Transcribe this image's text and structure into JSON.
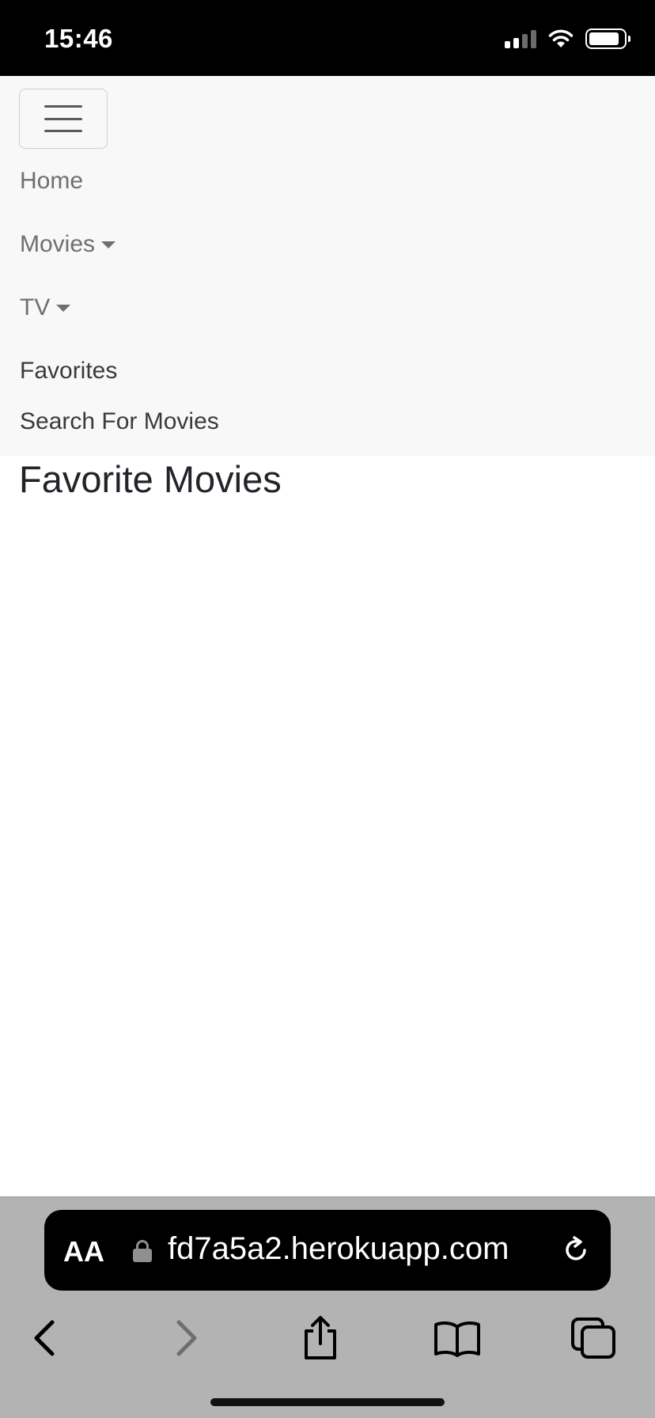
{
  "status_bar": {
    "time": "15:46",
    "icons": [
      "signal-icon",
      "wifi-icon",
      "battery-icon"
    ]
  },
  "navbar": {
    "toggler_icon": "hamburger-icon",
    "links": {
      "home": "Home",
      "movies": "Movies",
      "tv": "TV",
      "favorites": "Favorites",
      "search": "Search For Movies"
    }
  },
  "main": {
    "title": "Favorite Movies"
  },
  "browser": {
    "text_size_label": "AA",
    "url": "fd7a5a2.herokuapp.com",
    "toolbar_icons": [
      "back-icon",
      "forward-icon",
      "share-icon",
      "bookmarks-icon",
      "tabs-icon"
    ]
  },
  "colors": {
    "navbar_bg": "#f8f8f8",
    "nav_link": "#6f6f6f",
    "nav_link_active": "#3a3a3a",
    "title": "#212529",
    "chrome_bg": "#b3b3b3"
  }
}
